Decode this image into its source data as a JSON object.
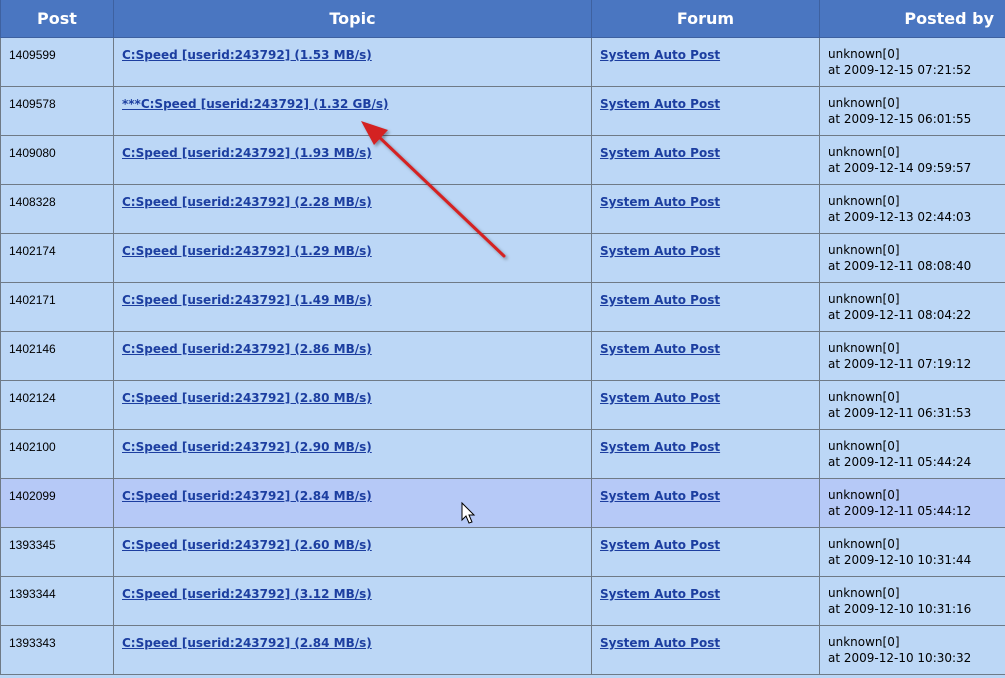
{
  "headers": {
    "post": "Post",
    "topic": "Topic",
    "forum": "Forum",
    "posted_by": "Posted by"
  },
  "rows": [
    {
      "post": "1409599",
      "topic": "C:Speed [userid:243792] (1.53 MB/s)",
      "forum": "System Auto Post",
      "author": "unknown[0]",
      "date": "at 2009-12-15 07:21:52"
    },
    {
      "post": "1409578",
      "topic": "***C:Speed [userid:243792] (1.32 GB/s)",
      "forum": "System Auto Post",
      "author": "unknown[0]",
      "date": "at 2009-12-15 06:01:55"
    },
    {
      "post": "1409080",
      "topic": "C:Speed [userid:243792] (1.93 MB/s)",
      "forum": "System Auto Post",
      "author": "unknown[0]",
      "date": "at 2009-12-14 09:59:57"
    },
    {
      "post": "1408328",
      "topic": "C:Speed [userid:243792] (2.28 MB/s)",
      "forum": "System Auto Post",
      "author": "unknown[0]",
      "date": "at 2009-12-13 02:44:03"
    },
    {
      "post": "1402174",
      "topic": "C:Speed [userid:243792] (1.29 MB/s)",
      "forum": "System Auto Post",
      "author": "unknown[0]",
      "date": "at 2009-12-11 08:08:40"
    },
    {
      "post": "1402171",
      "topic": "C:Speed [userid:243792] (1.49 MB/s)",
      "forum": "System Auto Post",
      "author": "unknown[0]",
      "date": "at 2009-12-11 08:04:22"
    },
    {
      "post": "1402146",
      "topic": "C:Speed [userid:243792] (2.86 MB/s)",
      "forum": "System Auto Post",
      "author": "unknown[0]",
      "date": "at 2009-12-11 07:19:12"
    },
    {
      "post": "1402124",
      "topic": "C:Speed [userid:243792] (2.80 MB/s)",
      "forum": "System Auto Post",
      "author": "unknown[0]",
      "date": "at 2009-12-11 06:31:53"
    },
    {
      "post": "1402100",
      "topic": "C:Speed [userid:243792] (2.90 MB/s)",
      "forum": "System Auto Post",
      "author": "unknown[0]",
      "date": "at 2009-12-11 05:44:24"
    },
    {
      "post": "1402099",
      "topic": "C:Speed [userid:243792] (2.84 MB/s)",
      "forum": "System Auto Post",
      "author": "unknown[0]",
      "date": "at 2009-12-11 05:44:12"
    },
    {
      "post": "1393345",
      "topic": "C:Speed [userid:243792] (2.60 MB/s)",
      "forum": "System Auto Post",
      "author": "unknown[0]",
      "date": "at 2009-12-10 10:31:44"
    },
    {
      "post": "1393344",
      "topic": "C:Speed [userid:243792] (3.12 MB/s)",
      "forum": "System Auto Post",
      "author": "unknown[0]",
      "date": "at 2009-12-10 10:31:16"
    },
    {
      "post": "1393343",
      "topic": "C:Speed [userid:243792] (2.84 MB/s)",
      "forum": "System Auto Post",
      "author": "unknown[0]",
      "date": "at 2009-12-10 10:30:32"
    }
  ],
  "colors": {
    "header_bg": "#4a76c1",
    "row_bg": "#bcd7f6",
    "hover_bg": "#b6c9f7",
    "link": "#1c3ea0",
    "annotation_arrow": "#d42020"
  },
  "annotation": {
    "arrow_icon": "red-arrow-icon",
    "points_to_row": 1
  },
  "hovered_row": 9,
  "cursor_icon": "mouse-pointer-icon"
}
